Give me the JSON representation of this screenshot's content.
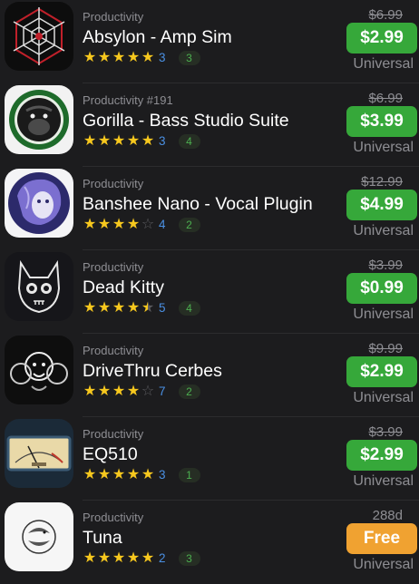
{
  "colors": {
    "background": "#1c1c1e",
    "star": "#f7c81e",
    "price_green": "#36a83a",
    "price_orange": "#f0a231",
    "rating_count": "#4a8fe2",
    "badge_text": "#4caf50"
  },
  "apps": [
    {
      "icon": "spider-web-emblem-icon",
      "category": "Productivity",
      "name": "Absylon - Amp Sim",
      "stars": [
        1,
        1,
        1,
        1,
        1
      ],
      "rating_count": "3",
      "badge": "3",
      "old_price": "$6.99",
      "price": "$2.99",
      "platform": "Universal"
    },
    {
      "icon": "gorilla-icon",
      "category": "Productivity #191",
      "name": "Gorilla - Bass Studio Suite",
      "stars": [
        1,
        1,
        1,
        1,
        1
      ],
      "rating_count": "3",
      "badge": "4",
      "old_price": "$6.99",
      "price": "$3.99",
      "platform": "Universal"
    },
    {
      "icon": "banshee-face-icon",
      "category": "Productivity",
      "name": "Banshee Nano - Vocal Plugin",
      "stars": [
        1,
        1,
        1,
        1,
        0
      ],
      "rating_count": "4",
      "badge": "2",
      "old_price": "$12.99",
      "price": "$4.99",
      "platform": "Universal"
    },
    {
      "icon": "cat-skull-icon",
      "category": "Productivity",
      "name": "Dead Kitty",
      "stars": [
        1,
        1,
        1,
        1,
        0.5
      ],
      "rating_count": "5",
      "badge": "4",
      "old_price": "$3.99",
      "price": "$0.99",
      "platform": "Universal"
    },
    {
      "icon": "three-headed-dog-icon",
      "category": "Productivity",
      "name": "DriveThru Cerbes",
      "stars": [
        1,
        1,
        1,
        1,
        0
      ],
      "rating_count": "7",
      "badge": "2",
      "old_price": "$9.99",
      "price": "$2.99",
      "platform": "Universal"
    },
    {
      "icon": "vu-meter-icon",
      "category": "Productivity",
      "name": "EQ510",
      "stars": [
        1,
        1,
        1,
        1,
        1
      ],
      "rating_count": "3",
      "badge": "1",
      "old_price": "$3.99",
      "price": "$2.99",
      "platform": "Universal"
    },
    {
      "icon": "tuna-fish-icon",
      "category": "Productivity",
      "name": "Tuna",
      "stars": [
        1,
        1,
        1,
        1,
        1
      ],
      "rating_count": "2",
      "badge": "3",
      "old_price": "288d",
      "price": "Free",
      "platform": "Universal"
    }
  ]
}
